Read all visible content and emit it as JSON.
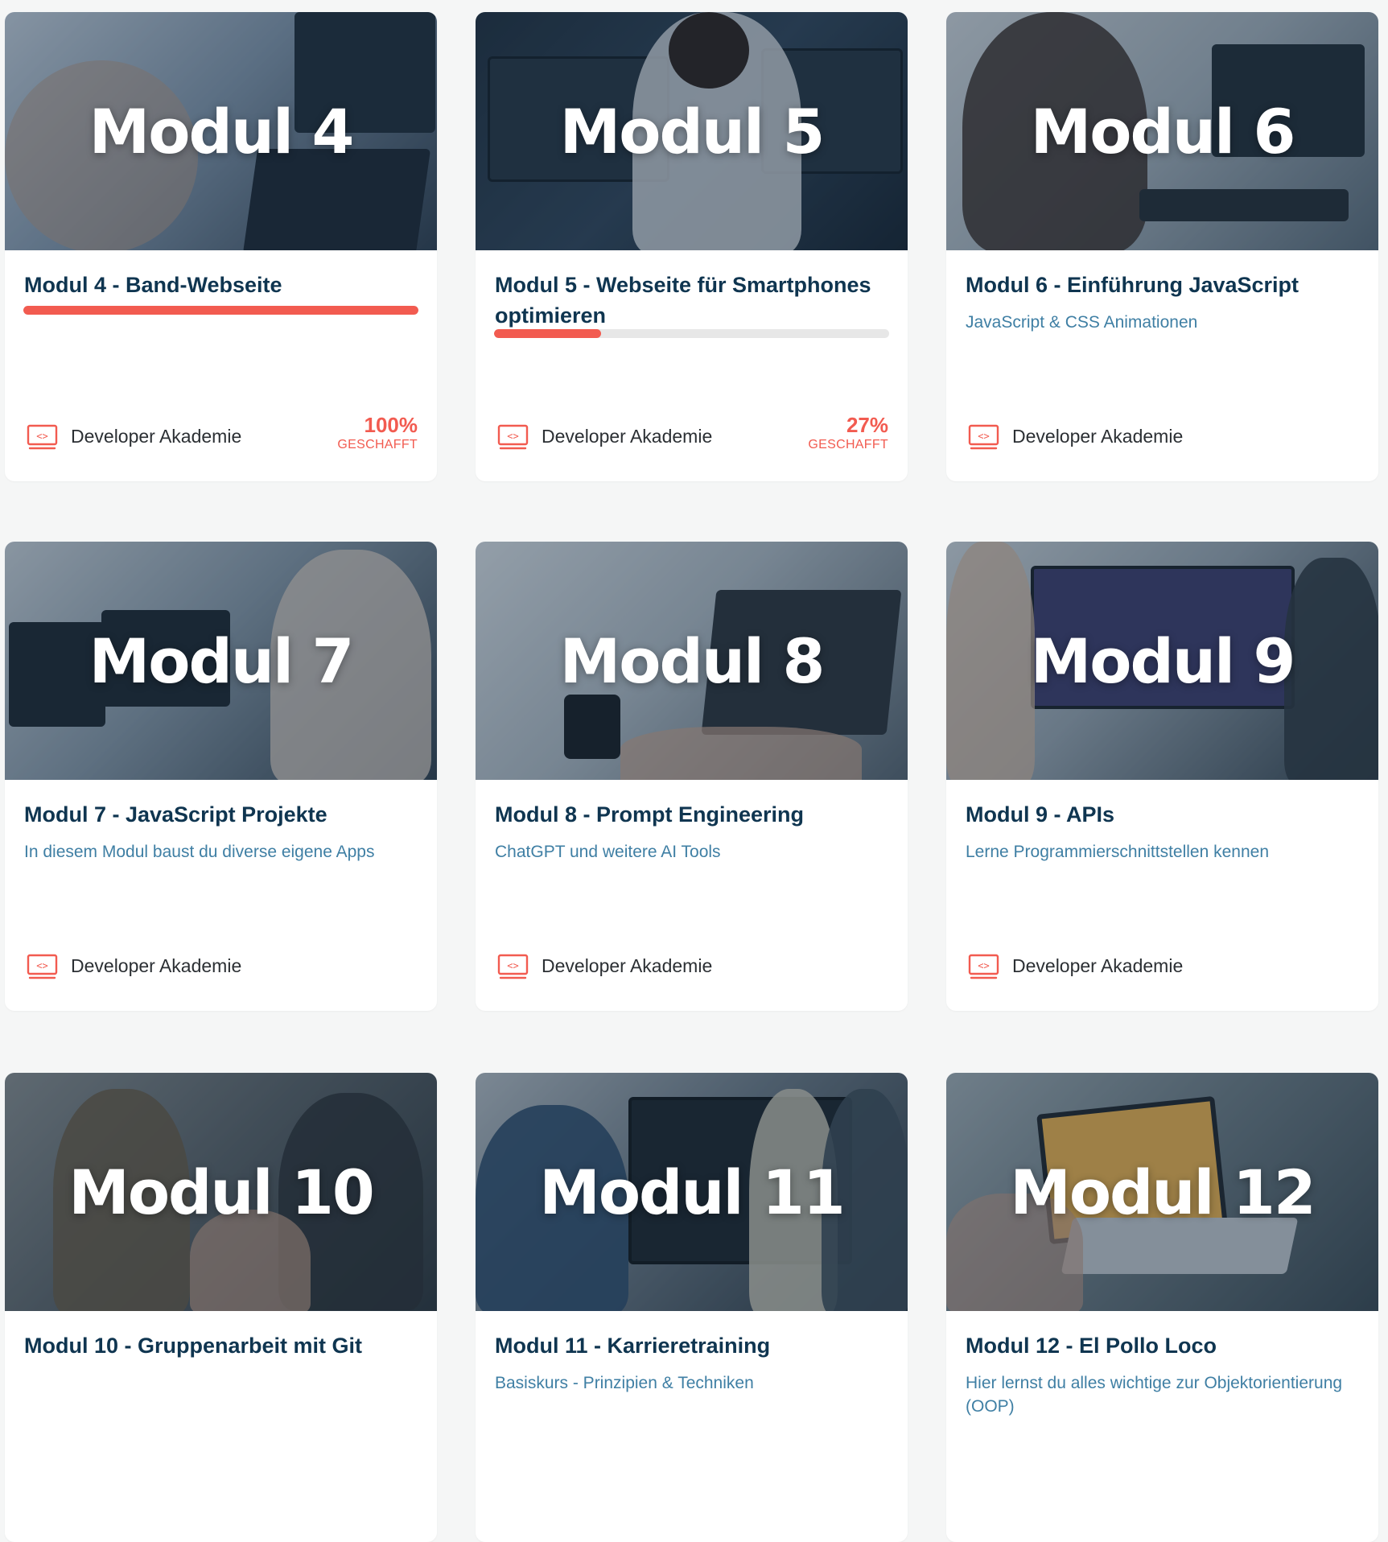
{
  "footer_label": "Developer Akademie",
  "progress_word": "GESCHAFFT",
  "accent_color": "#f25b50",
  "title_color": "#0f3550",
  "subtitle_color": "#3f7fa4",
  "icon": "developer-akademie-code-icon",
  "modules": [
    {
      "badge": "Modul 4",
      "title": "Modul 4 - Band-Webseite",
      "subtitle": "",
      "progress_percent": 100,
      "progress_text": "100%"
    },
    {
      "badge": "Modul 5",
      "title": "Modul 5 - Webseite für Smartphones optimieren",
      "subtitle": "",
      "progress_percent": 27,
      "progress_text": "27%"
    },
    {
      "badge": "Modul 6",
      "title": "Modul 6 - Einführung JavaScript",
      "subtitle": "JavaScript & CSS Animationen"
    },
    {
      "badge": "Modul 7",
      "title": "Modul 7 - JavaScript Projekte",
      "subtitle": "In diesem Modul baust du diverse eigene Apps"
    },
    {
      "badge": "Modul 8",
      "title": "Modul 8 - Prompt Engineering",
      "subtitle": "ChatGPT und weitere AI Tools"
    },
    {
      "badge": "Modul 9",
      "title": "Modul 9 - APIs",
      "subtitle": "Lerne Programmierschnittstellen kennen"
    },
    {
      "badge": "Modul 10",
      "title": "Modul 10 - Gruppenarbeit mit Git",
      "subtitle": ""
    },
    {
      "badge": "Modul 11",
      "title": "Modul 11 - Karrieretraining",
      "subtitle": "Basiskurs - Prinzipien & Techniken"
    },
    {
      "badge": "Modul 12",
      "title": "Modul 12 - El Pollo Loco",
      "subtitle": "Hier lernst du alles wichtige zur Objektorientierung (OOP)"
    }
  ]
}
